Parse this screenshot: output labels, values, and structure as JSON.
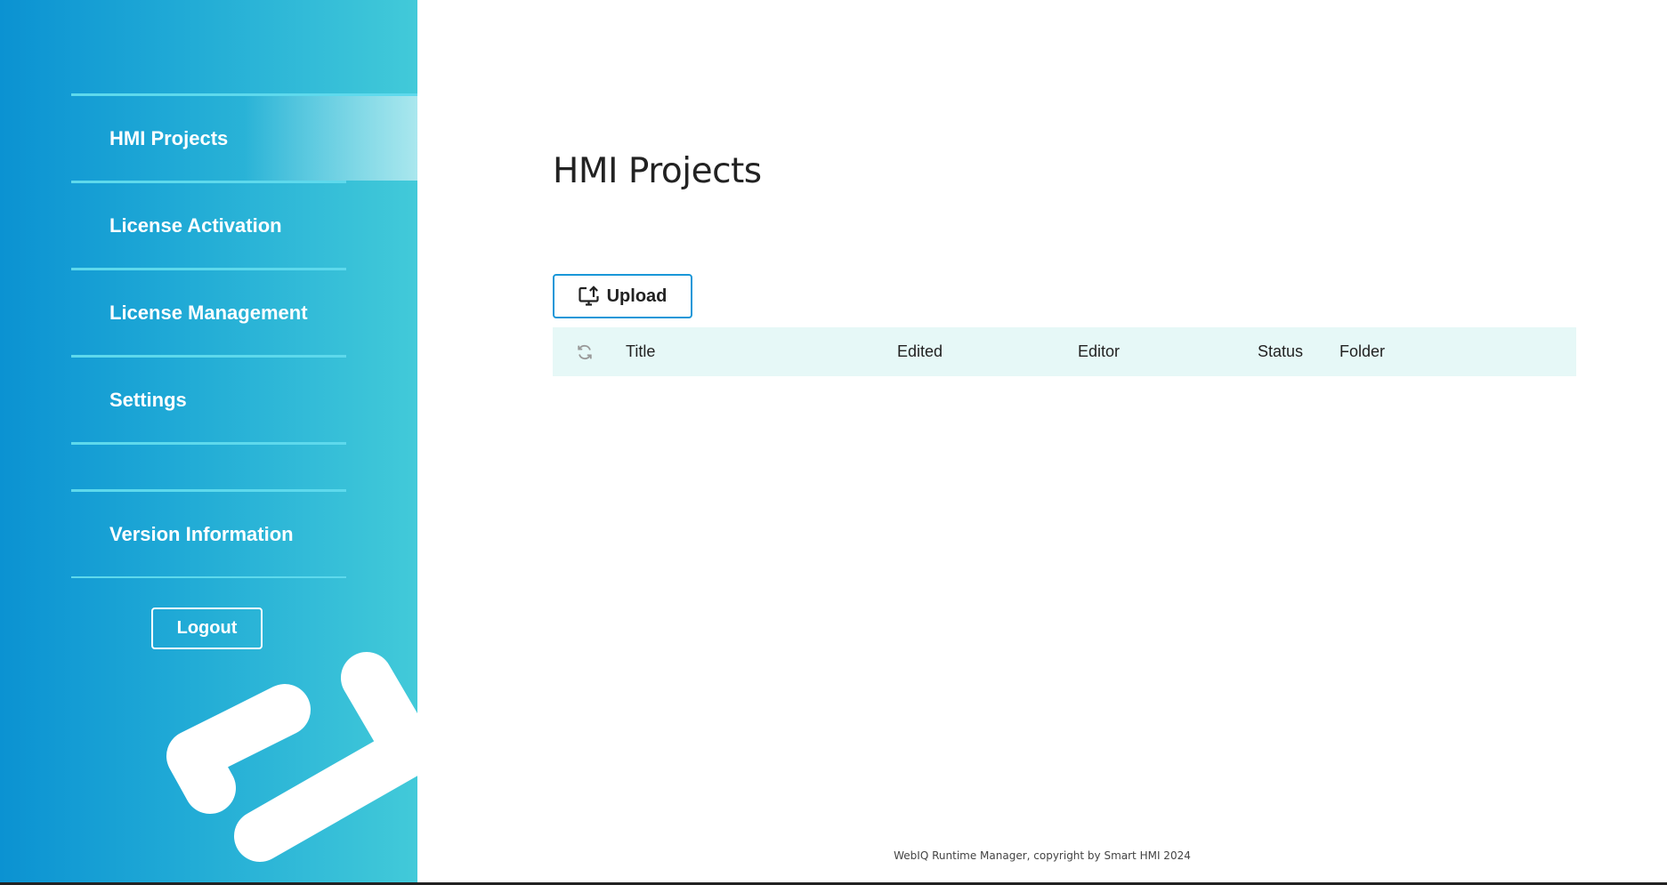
{
  "sidebar": {
    "items": [
      {
        "label": "HMI Projects",
        "active": true
      },
      {
        "label": "License Activation"
      },
      {
        "label": "License Management"
      },
      {
        "label": "Settings"
      },
      {
        "label": "Version Information"
      }
    ],
    "logout_label": "Logout",
    "gradient_colors": [
      "#0b92d2",
      "#42cad9"
    ],
    "divider_color": "#5ed9ec"
  },
  "main": {
    "title": "HMI Projects",
    "upload_label": "Upload",
    "upload_icon": "upload-monitor-icon",
    "table": {
      "refresh_icon": "refresh-icon",
      "columns": [
        "Title",
        "Edited",
        "Editor",
        "Status",
        "Folder"
      ],
      "rows": []
    },
    "accent_color": "#1997d8",
    "header_bg": "#e6f8f7"
  },
  "footer": {
    "text": "WebIQ Runtime Manager, copyright by Smart HMI 2024"
  }
}
